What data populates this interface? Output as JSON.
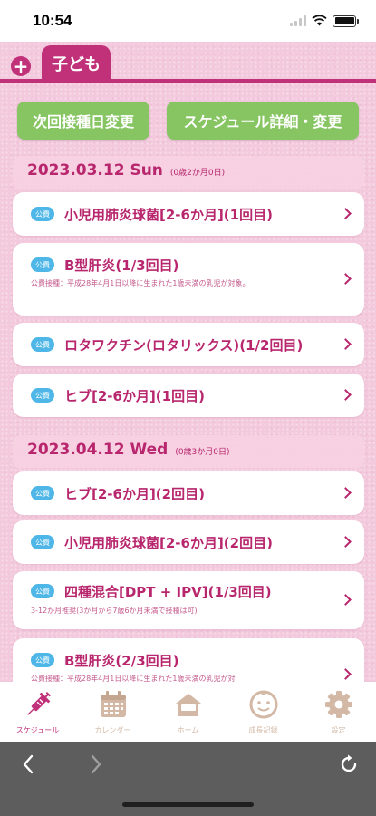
{
  "status_bar": {
    "time": "10:54"
  },
  "tabs": {
    "add_label": "+",
    "child_name": "子ども"
  },
  "actions": {
    "next_date": "次回接種日変更",
    "schedule_detail": "スケジュール詳細・変更"
  },
  "sections": [
    {
      "date": "2023.03.12 Sun",
      "age": "(0歳2か月0日)",
      "items": [
        {
          "badge": "公費",
          "title": "小児用肺炎球菌[2-6か月](1回目)",
          "note": ""
        },
        {
          "badge": "公費",
          "title": "B型肝炎(1/3回目)",
          "note": "公費接種：平成28年4月1日以降に生まれた1歳未満の乳児が対象。"
        },
        {
          "badge": "公費",
          "title": "ロタワクチン(ロタリックス)(1/2回目)",
          "note": ""
        },
        {
          "badge": "公費",
          "title": "ヒブ[2-6か月](1回目)",
          "note": ""
        }
      ]
    },
    {
      "date": "2023.04.12 Wed",
      "age": "(0歳3か月0日)",
      "items": [
        {
          "badge": "公費",
          "title": "ヒブ[2-6か月](2回目)",
          "note": ""
        },
        {
          "badge": "公費",
          "title": "小児用肺炎球菌[2-6か月](2回目)",
          "note": ""
        },
        {
          "badge": "公費",
          "title": "四種混合[DPT + IPV](1/3回目)",
          "note": "3-12か月推奨(3か月から7歳6か月未満で接種は可)"
        },
        {
          "badge": "公費",
          "title": "B型肝炎(2/3回目)",
          "note": "公費接種：平成28年4月1日以降に生まれた1歳未満の乳児が対"
        }
      ]
    }
  ],
  "tab_bar": [
    {
      "label": "スケジュール",
      "icon": "syringe-icon",
      "active": true
    },
    {
      "label": "カレンダー",
      "icon": "calendar-icon",
      "active": false
    },
    {
      "label": "ホーム",
      "icon": "home-icon",
      "active": false
    },
    {
      "label": "成長記録",
      "icon": "baby-face-icon",
      "active": false
    },
    {
      "label": "設定",
      "icon": "gear-icon",
      "active": false
    }
  ],
  "colors": {
    "accent": "#c0317a",
    "button_green": "#86c562",
    "badge_blue": "#4fb7e8",
    "tab_inactive": "#d2b8a5"
  }
}
